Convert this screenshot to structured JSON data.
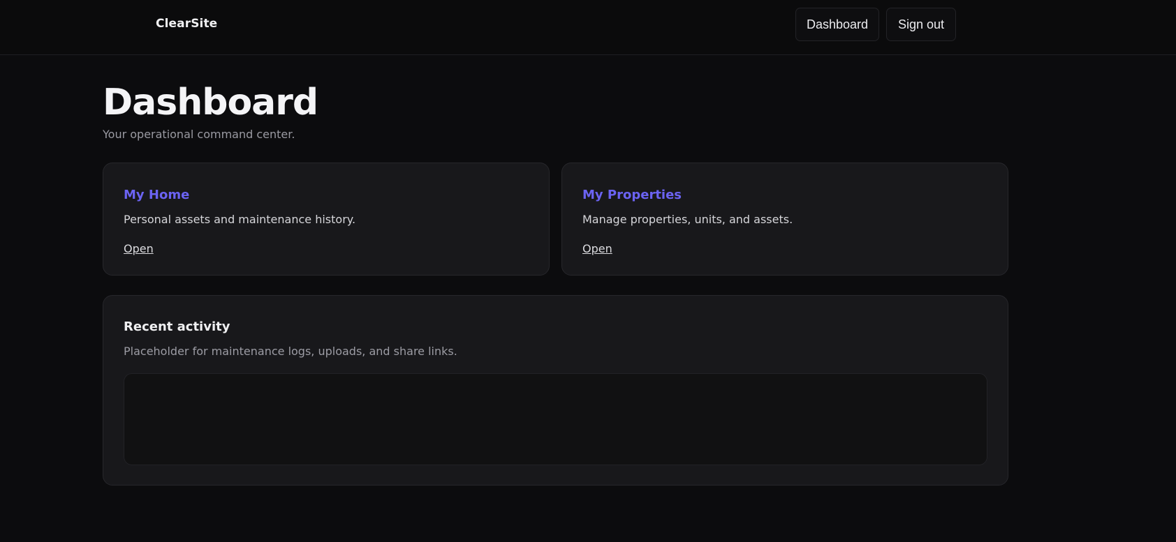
{
  "header": {
    "brand": "ClearSite",
    "nav": {
      "dashboard_label": "Dashboard",
      "signout_label": "Sign out"
    }
  },
  "page": {
    "title": "Dashboard",
    "subtitle": "Your operational command center."
  },
  "cards": [
    {
      "title": "My Home",
      "description": "Personal assets and maintenance history.",
      "link_label": "Open"
    },
    {
      "title": "My Properties",
      "description": "Manage properties, units, and assets.",
      "link_label": "Open"
    }
  ],
  "activity": {
    "title": "Recent activity",
    "description": "Placeholder for maintenance logs, uploads, and share links."
  },
  "colors": {
    "background": "#0c0c0e",
    "card": "#18181b",
    "accent": "#6b63f2"
  }
}
